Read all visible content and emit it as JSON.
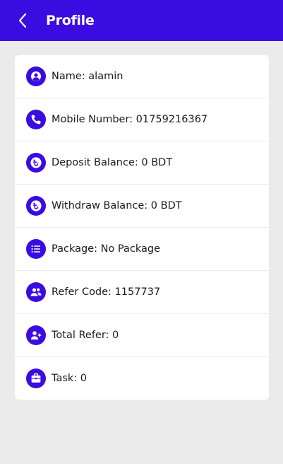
{
  "header": {
    "title": "Profile",
    "accent_color": "#3a0ce0"
  },
  "profile": {
    "rows": [
      {
        "label": "Name:",
        "value": "alamin",
        "icon": "user-circle-icon"
      },
      {
        "label": "Mobile Number:",
        "value": "01759216367",
        "icon": "phone-icon"
      },
      {
        "label": "Deposit Balance:",
        "value": "0 BDT",
        "icon": "taka-icon"
      },
      {
        "label": "Withdraw Balance:",
        "value": "0 BDT",
        "icon": "taka-icon"
      },
      {
        "label": "Package:",
        "value": "No Package",
        "icon": "list-icon"
      },
      {
        "label": "Refer Code:",
        "value": "1157737",
        "icon": "users-icon"
      },
      {
        "label": "Total Refer:",
        "value": "0",
        "icon": "user-plus-icon"
      },
      {
        "label": "Task:",
        "value": "0",
        "icon": "briefcase-icon"
      }
    ]
  }
}
